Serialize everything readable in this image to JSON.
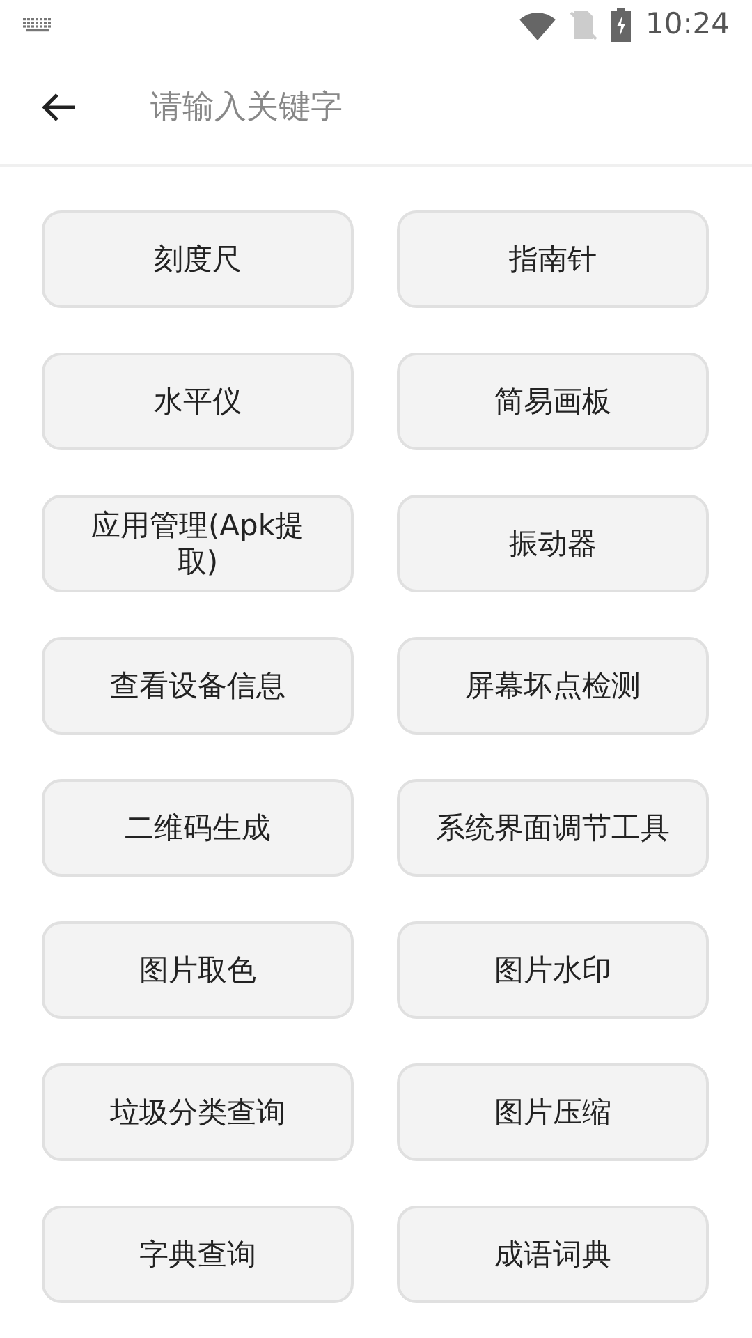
{
  "status_bar": {
    "time": "10:24"
  },
  "search": {
    "placeholder": "请输入关键字"
  },
  "tools": [
    {
      "label": "刻度尺"
    },
    {
      "label": "指南针"
    },
    {
      "label": "水平仪"
    },
    {
      "label": "简易画板"
    },
    {
      "label": "应用管理(Apk提取)"
    },
    {
      "label": "振动器"
    },
    {
      "label": "查看设备信息"
    },
    {
      "label": "屏幕坏点检测"
    },
    {
      "label": "二维码生成"
    },
    {
      "label": "系统界面调节工具"
    },
    {
      "label": "图片取色"
    },
    {
      "label": "图片水印"
    },
    {
      "label": "垃圾分类查询"
    },
    {
      "label": "图片压缩"
    },
    {
      "label": "字典查询"
    },
    {
      "label": "成语词典"
    }
  ]
}
